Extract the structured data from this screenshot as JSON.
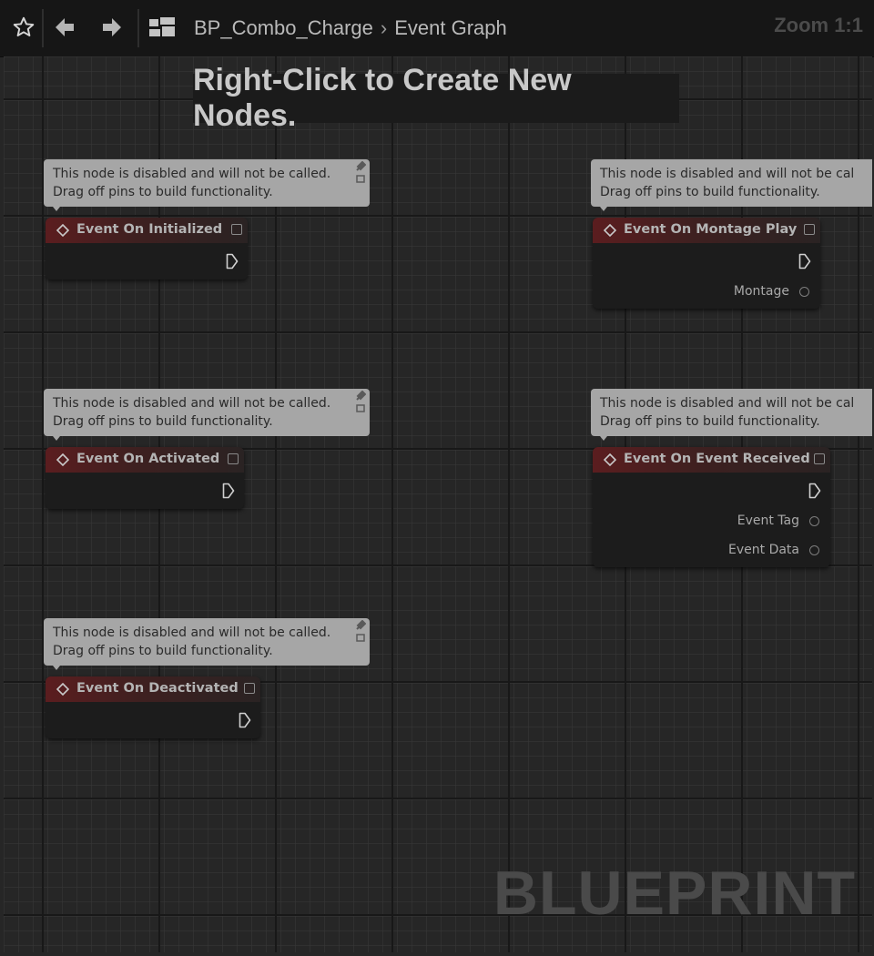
{
  "toolbar": {
    "breadcrumb": [
      "BP_Combo_Charge",
      "Event Graph"
    ],
    "zoom": "Zoom 1:1"
  },
  "graph": {
    "hint": "Right-Click to Create New Nodes.",
    "watermark": "BLUEPRINT",
    "nodes": [
      {
        "title": "Event On Initialized",
        "comment": [
          "This node is disabled and will not be called.",
          "Drag off pins to build functionality."
        ],
        "pins": []
      },
      {
        "title": "Event On Montage Play",
        "comment": [
          "This node is disabled and will not be cal",
          "Drag off pins to build functionality."
        ],
        "pins": [
          "Montage"
        ]
      },
      {
        "title": "Event On Activated",
        "comment": [
          "This node is disabled and will not be called.",
          "Drag off pins to build functionality."
        ],
        "pins": []
      },
      {
        "title": "Event On Event Received",
        "comment": [
          "This node is disabled and will not be cal",
          "Drag off pins to build functionality."
        ],
        "pins": [
          "Event Tag",
          "Event Data"
        ]
      },
      {
        "title": "Event On Deactivated",
        "comment": [
          "This node is disabled and will not be called.",
          "Drag off pins to build functionality."
        ],
        "pins": []
      }
    ]
  },
  "colors": {
    "background": "#262626",
    "node_header": "#5b1d1f",
    "comment_bubble": "#a6a6a6"
  }
}
